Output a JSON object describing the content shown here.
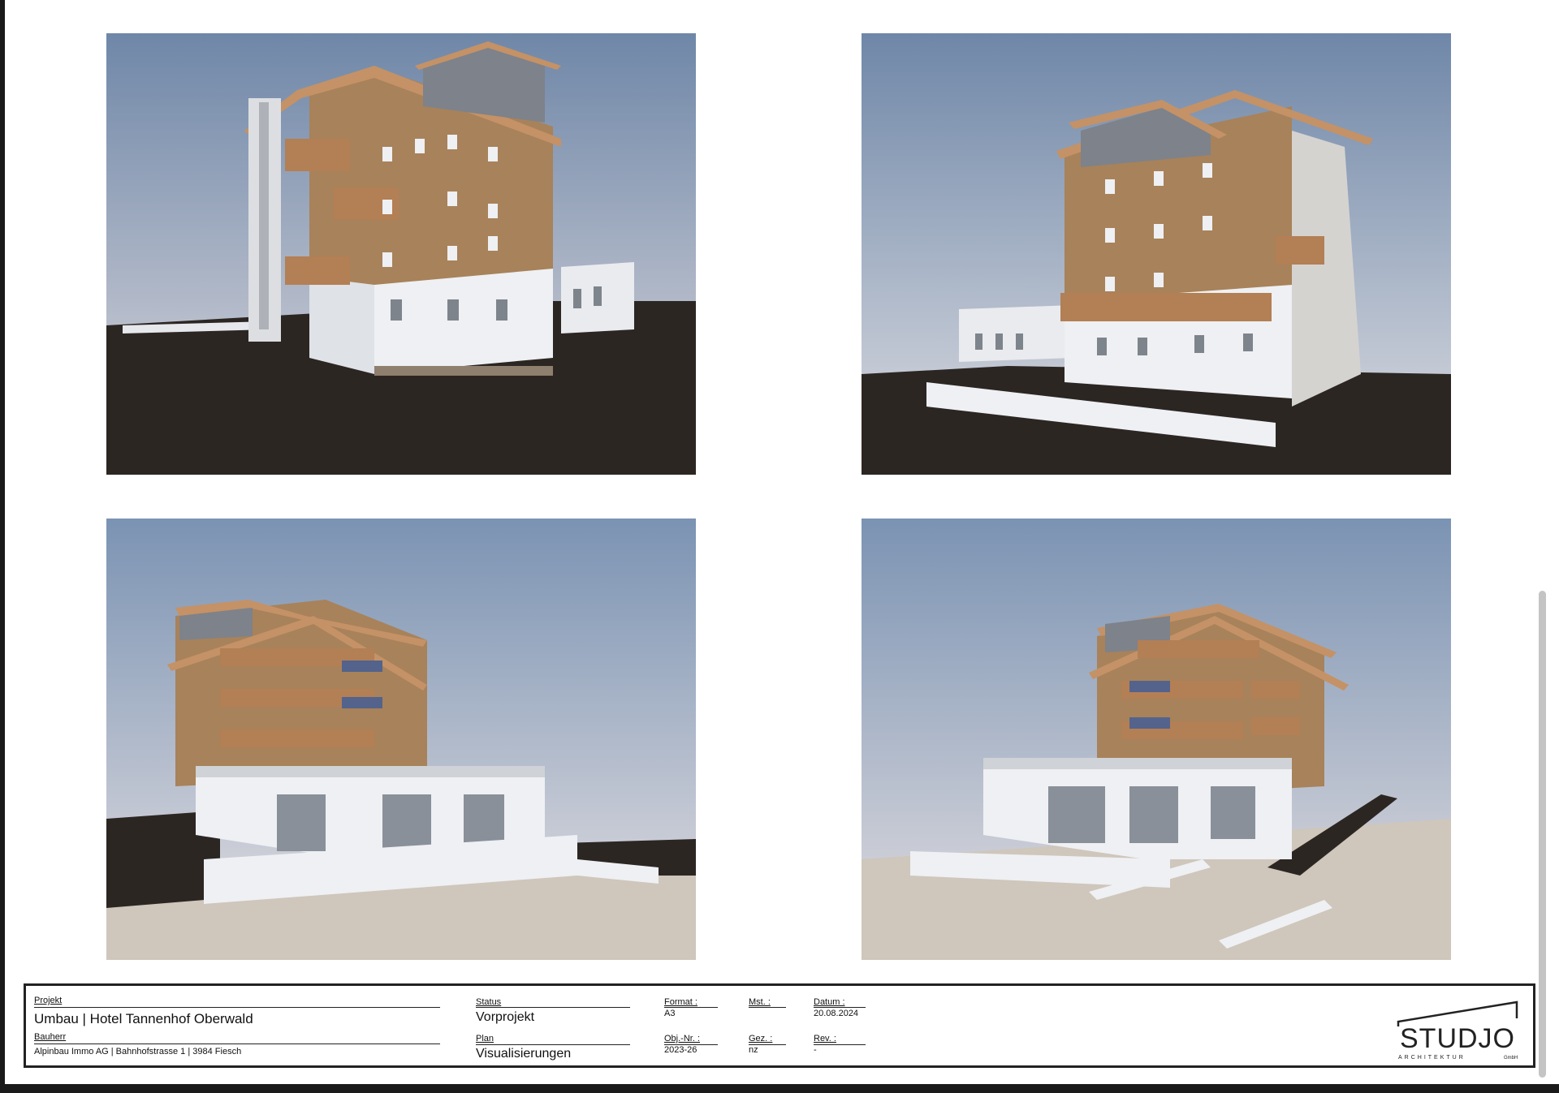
{
  "titleblock": {
    "projekt_label": "Projekt",
    "projekt_value": "Umbau | Hotel Tannenhof Oberwald",
    "bauherr_label": "Bauherr",
    "bauherr_value": "Alpinbau Immo AG | Bahnhofstrasse 1 | 3984 Fiesch",
    "status_label": "Status",
    "status_value": "Vorprojekt",
    "plan_label": "Plan",
    "plan_value": "Visualisierungen",
    "format_label": "Format :",
    "format_value": "A3",
    "objnr_label": "Obj.-Nr. :",
    "objnr_value": "2023-26",
    "mst_label": "Mst. :",
    "mst_value": "",
    "gez_label": "Gez. :",
    "gez_value": "nz",
    "datum_label": "Datum :",
    "datum_value": "20.08.2024",
    "rev_label": "Rev. :",
    "rev_value": "-"
  },
  "logo": {
    "name": "STUDJO",
    "subtitle": "ARCHITEKTUR",
    "suffix": "GmbH"
  },
  "renders": [
    {
      "view": "front-left aerial"
    },
    {
      "view": "rear-right aerial"
    },
    {
      "view": "pavilion side left"
    },
    {
      "view": "pavilion side right"
    }
  ],
  "colors": {
    "sky_top": "#6f87a8",
    "sky_bottom": "#d9dde6",
    "wood": "#a8825a",
    "roof": "#c49266",
    "wall": "#eef0f3",
    "ground_dark": "#2c2623",
    "ground_light": "#cfc6bc"
  }
}
